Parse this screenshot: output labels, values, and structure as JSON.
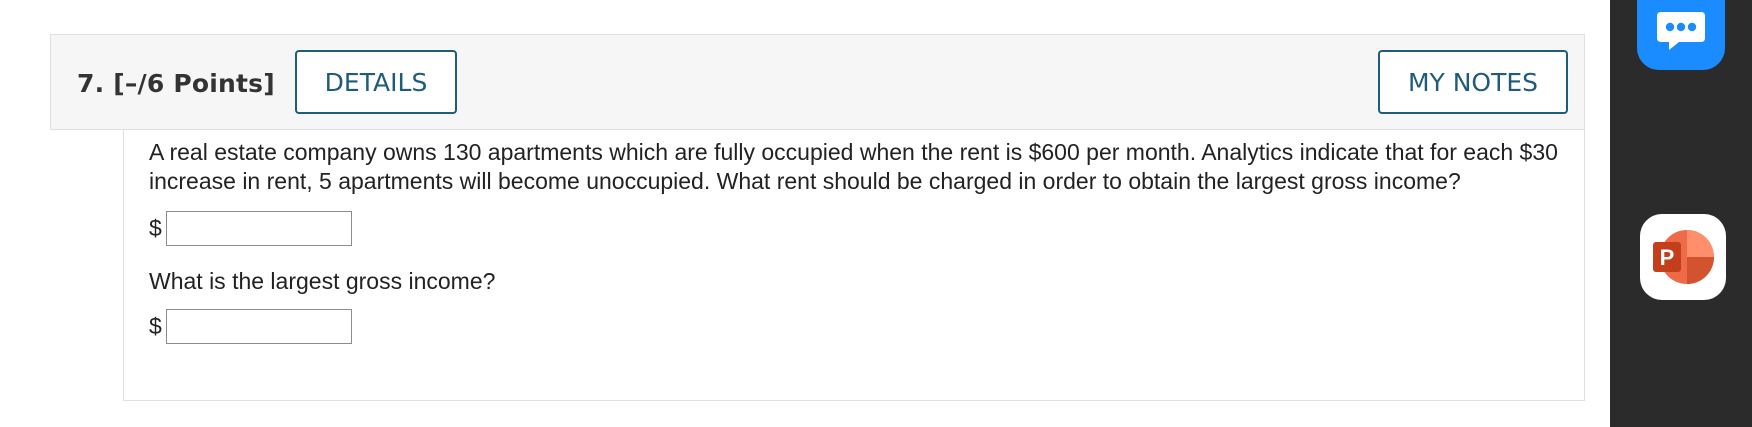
{
  "question": {
    "number_label": "7.  [–/6 Points]",
    "details_button": "DETAILS",
    "notes_button": "MY NOTES",
    "prompt": "A real estate company owns 130 apartments which are fully occupied when the rent is $600 per month. Analytics indicate that for each $30 increase in rent, 5 apartments will become unoccupied. What rent should be charged in order to obtain the largest gross income?",
    "answer1": {
      "prefix": "$",
      "value": ""
    },
    "sub_prompt": "What is the largest gross income?",
    "answer2": {
      "prefix": "$",
      "value": ""
    }
  },
  "side_panel": {
    "icons": [
      "chat-bubble-icon",
      "powerpoint-icon"
    ],
    "colors": {
      "panel": "#2b2b2b",
      "chat": "#1a8cff",
      "powerpoint": "#d24726"
    },
    "powerpoint_letter": "P"
  },
  "colors": {
    "accent": "#1f5c7a",
    "header_bg": "#f6f6f6"
  }
}
